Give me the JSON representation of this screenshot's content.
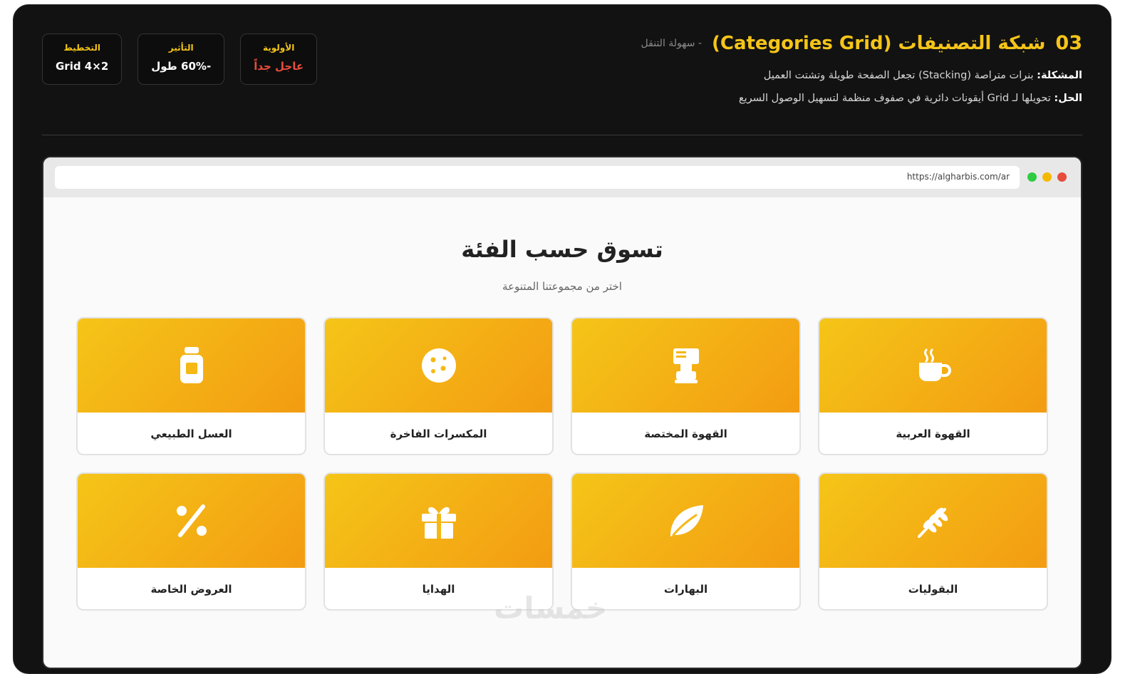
{
  "section": {
    "number": "03",
    "title": "شبكة التصنيفات (Categories Grid)",
    "tag": "- سهولة التنقل",
    "problem_label": "المشكلة:",
    "problem_text": "بنرات متراصة (Stacking) تجعل الصفحة طويلة وتشتت العميل",
    "solution_label": "الحل:",
    "solution_text": "تحويلها لـ Grid أيقونات دائرية في صفوف منظمة لتسهيل الوصول السريع"
  },
  "badges": [
    {
      "label": "الأولوية",
      "value": "عاجل جداً"
    },
    {
      "label": "التأثير",
      "value": "-60% طول"
    },
    {
      "label": "التخطيط",
      "value": "Grid 4×2"
    }
  ],
  "browser": {
    "url": "https://algharbis.com/ar",
    "dots": [
      "#e74c3c",
      "#f5b800",
      "#2ecc40"
    ]
  },
  "page": {
    "heading": "تسوق حسب الفئة",
    "subheading": "اختر من مجموعتنا المتنوعة"
  },
  "categories": [
    {
      "label": "القهوة العربية",
      "icon": "coffee-cup-icon"
    },
    {
      "label": "القهوة المختصة",
      "icon": "coffee-machine-icon"
    },
    {
      "label": "المكسرات الفاخرة",
      "icon": "cookie-icon"
    },
    {
      "label": "العسل الطبيعي",
      "icon": "jar-icon"
    },
    {
      "label": "البقوليات",
      "icon": "wheat-icon"
    },
    {
      "label": "البهارات",
      "icon": "leaf-icon"
    },
    {
      "label": "الهدايا",
      "icon": "gift-icon"
    },
    {
      "label": "العروض الخاصة",
      "icon": "percent-icon"
    }
  ],
  "watermark": "خمسات",
  "colors": {
    "accent": "#f5c518",
    "tile_gradient_start": "#f5c518",
    "tile_gradient_end": "#f39c12",
    "priority_value": "#e74c3c"
  }
}
